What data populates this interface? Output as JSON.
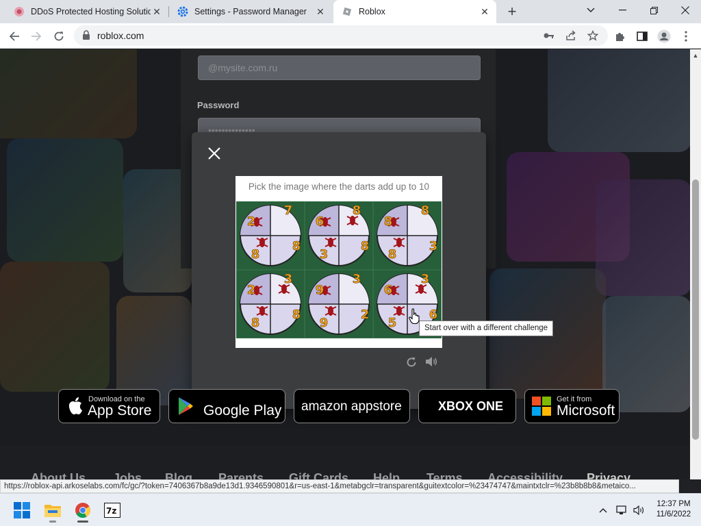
{
  "browser": {
    "tabs": [
      {
        "title": "DDoS Protected Hosting Solutions",
        "icon": "site-favicon",
        "active": false
      },
      {
        "title": "Settings - Password Manager",
        "icon": "gear-icon",
        "active": false
      },
      {
        "title": "Roblox",
        "icon": "roblox-favicon",
        "active": true
      }
    ],
    "url": "roblox.com",
    "status_url": "https://roblox-api.arkoselabs.com/fc/gc/?token=7406367b8a9de13d1.9346590801&r=us-east-1&metabgclr=transparent&guitextcolor=%23474747&maintxtclr=%23b8b8b8&metaico..."
  },
  "login": {
    "username_placeholder": "@mysite.com.ru",
    "password_label": "Password",
    "password_placeholder": "••••••••••••••"
  },
  "captcha": {
    "prompt": "Pick the image where the darts add up to 10",
    "tooltip": "Start over with a different challenge",
    "tiles": [
      {
        "numbers": [
          "2",
          "7",
          "8",
          "8"
        ]
      },
      {
        "numbers": [
          "6",
          "8",
          "8",
          "3"
        ]
      },
      {
        "numbers": [
          "8",
          "8",
          "3",
          "8"
        ]
      },
      {
        "numbers": [
          "2",
          "3",
          "8",
          "8"
        ]
      },
      {
        "numbers": [
          "9",
          "3",
          "2",
          "9"
        ]
      },
      {
        "numbers": [
          "6",
          "3",
          "6",
          "5"
        ]
      }
    ]
  },
  "stores": {
    "apple_small": "Download on the",
    "apple_big": "App Store",
    "google_big": "Google Play",
    "amazon_big": "amazon appstore",
    "xbox_big": "XBOX ONE",
    "ms_small": "Get it from",
    "ms_big": "Microsoft"
  },
  "footer_links": [
    "About Us",
    "Jobs",
    "Blog",
    "Parents",
    "Gift Cards",
    "Help",
    "Terms",
    "Accessibility",
    "Privacy"
  ],
  "taskbar": {
    "time": "12:37 PM",
    "date": "11/6/2022"
  }
}
